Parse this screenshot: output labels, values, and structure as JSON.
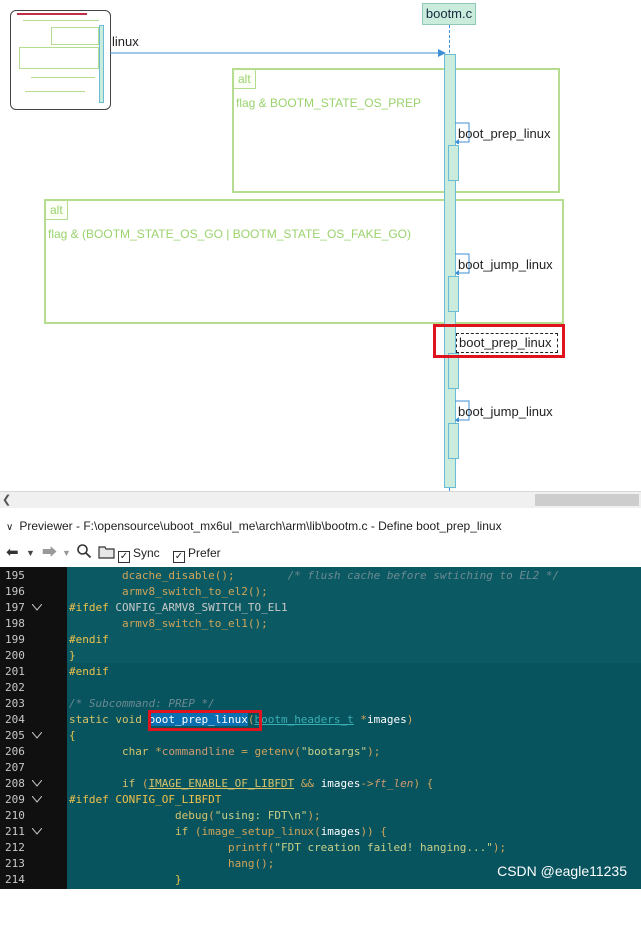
{
  "diagram": {
    "lifeline_label": "bootm.c",
    "incoming_label": "linux",
    "alt_frames": [
      {
        "tag": "alt",
        "guard": "flag & BOOTM_STATE_OS_PREP"
      },
      {
        "tag": "alt",
        "guard": "flag & (BOOTM_STATE_OS_GO | BOOTM_STATE_OS_FAKE_GO)"
      }
    ],
    "self_calls": [
      "boot_prep_linux",
      "boot_jump_linux",
      "boot_prep_linux",
      "boot_jump_linux"
    ],
    "colors": {
      "frame": "#b6dc8f",
      "lifeline": "#c9ecdc",
      "highlight": "#e0141e"
    }
  },
  "previewer": {
    "title": "Previewer - F:\\opensource\\uboot_mx6ul_me\\arch\\arm\\lib\\bootm.c - Define boot_prep_linux",
    "sync_label": "Sync",
    "prefer_label": "Prefer",
    "sync_checked": true,
    "prefer_checked": true
  },
  "code": {
    "line_numbers": [
      "195",
      "196",
      "197",
      "198",
      "199",
      "200",
      "201",
      "202",
      "203",
      "204",
      "205",
      "206",
      "207",
      "208",
      "209",
      "210",
      "211",
      "212",
      "213",
      "214"
    ],
    "l195_a": "dcache_disable",
    "l195_b": "/* flush cache before swtiching to EL2 */",
    "l196": "armv8_switch_to_el2",
    "l197_a": "#ifdef",
    "l197_b": "CONFIG_ARMV8_SWITCH_TO_EL1",
    "l198": "armv8_switch_to_el1",
    "l199": "#endif",
    "l200": "}",
    "l201": "#endif",
    "l203": "/* Subcommand: PREP */",
    "l204_kw": "static void",
    "l204_fn": "boot_prep_linux",
    "l204_ty": "bootm_headers_t",
    "l204_arg": "images",
    "l205": "{",
    "l206_kw": "char",
    "l206_var": "commandline",
    "l206_fn": "getenv",
    "l206_str": "\"bootargs\"",
    "l208_kw": "if",
    "l208_macro": "IMAGE_ENABLE_OF_LIBFDT",
    "l208_var": "images",
    "l208_field": "ft_len",
    "l209_a": "#ifdef",
    "l209_b": "CONFIG_OF_LIBFDT",
    "l210_fn": "debug",
    "l210_str": "\"using: FDT\\n\"",
    "l211_kw": "if",
    "l211_fn": "image_setup_linux",
    "l211_var": "images",
    "l212_fn": "printf",
    "l212_str": "\"FDT creation failed! hanging...\"",
    "l213_fn": "hang",
    "l214": "}"
  },
  "watermark": "CSDN @eagle11235"
}
